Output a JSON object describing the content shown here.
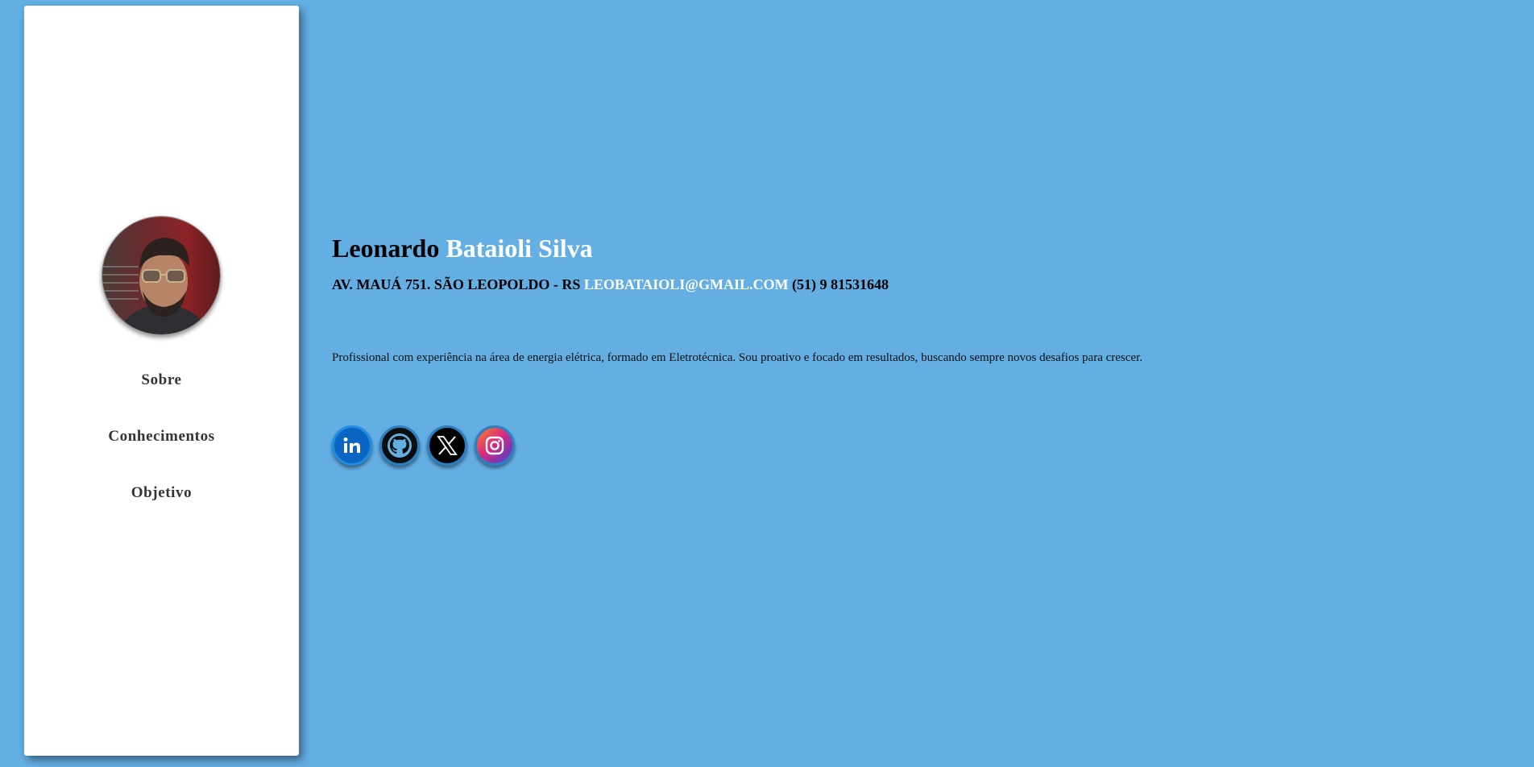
{
  "sidebar": {
    "avatar_alt": "Foto de perfil",
    "nav": [
      {
        "label": "Sobre"
      },
      {
        "label": "Conhecimentos"
      },
      {
        "label": "Objetivo"
      }
    ]
  },
  "header": {
    "first_name": "Leonardo",
    "last_name": "Bataioli Silva",
    "address": "AV. MAUÁ 751. SÃO LEOPOLDO - RS",
    "email": "LEOBATAIOLI@GMAIL.COM",
    "phone": "(51) 9 81531648"
  },
  "about": {
    "text": "Profissional com experiência na área de energia elétrica, formado em Eletrotécnica. Sou proativo e focado em resultados, buscando sempre novos desafios para crescer."
  },
  "socials": [
    {
      "icon": "linkedin-icon",
      "color": "#0a66c2"
    },
    {
      "icon": "github-icon",
      "color": "#0d0d0d"
    },
    {
      "icon": "x-icon",
      "color": "#000000"
    },
    {
      "icon": "instagram-icon",
      "color": "#d6249f"
    }
  ],
  "colors": {
    "background": "#63aee3",
    "accent": "#ffffff",
    "sidebar": "#ffffff"
  }
}
